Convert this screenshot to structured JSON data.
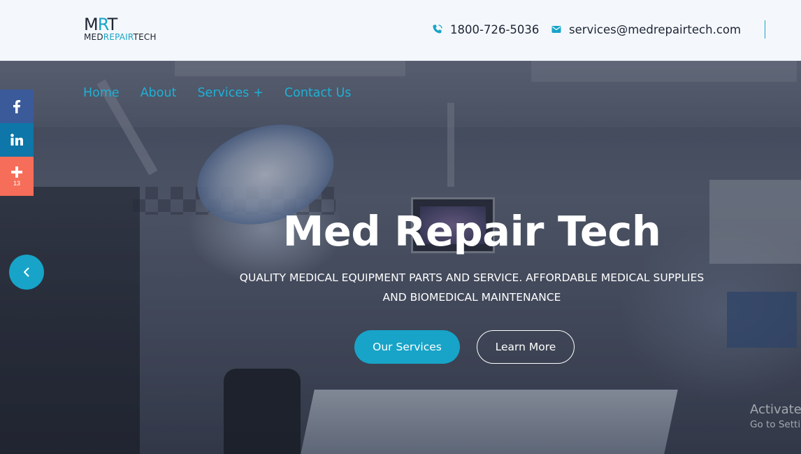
{
  "header": {
    "logo_mark": {
      "m": "M",
      "r": "R",
      "t": "T"
    },
    "logo_word": {
      "start": "MED",
      "middle": "REPAIR",
      "end": "TECH"
    },
    "phone": "1800-726-5036",
    "email": "services@medrepairtech.com"
  },
  "nav": {
    "items": [
      {
        "label": "Home"
      },
      {
        "label": "About"
      },
      {
        "label": "Services"
      },
      {
        "label": "Contact Us"
      }
    ],
    "services_expand": "+"
  },
  "hero": {
    "title": "Med Repair Tech",
    "subtitle": "QUALITY MEDICAL EQUIPMENT PARTS AND SERVICE. AFFORDABLE MEDICAL SUPPLIES AND BIOMEDICAL MAINTENANCE",
    "primary_button": "Our Services",
    "secondary_button": "Learn More"
  },
  "share": {
    "count": "13",
    "icons": [
      "facebook-icon",
      "linkedin-icon",
      "plus-icon"
    ]
  },
  "slider": {
    "prev_icon": "chevron-left-icon"
  },
  "watermark": {
    "line1": "Activate",
    "line2": "Go to Setti"
  },
  "colors": {
    "accent": "#17a4c8",
    "facebook": "#3b5a9a",
    "linkedin": "#0e76a8",
    "share_more": "#f66d59"
  }
}
